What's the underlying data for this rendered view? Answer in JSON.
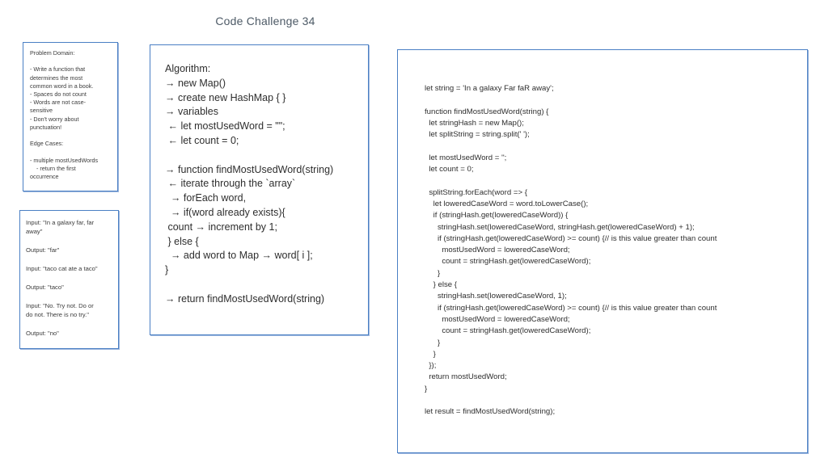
{
  "title": "Code Challenge 34",
  "problem_domain": {
    "lines": [
      "Problem Domain:",
      "",
      "- Write a function that",
      "determines the most",
      "common word in a book.",
      "- Spaces do not count",
      "- Words are not case-",
      "sensitive",
      "- Don't worry about",
      "punctuation!",
      "",
      "Edge Cases:",
      "",
      "- multiple mostUsedWords",
      "    - return the first",
      "occurrence"
    ]
  },
  "examples": {
    "lines": [
      "Input: \"In a galaxy far, far",
      "away\"",
      "",
      "Output: \"far\"",
      "",
      "Input: \"taco cat ate a taco\"",
      "",
      "Output: \"taco\"",
      "",
      "Input: \"No. Try not. Do or",
      "do not. There is no try.\"",
      "",
      "Output: \"no\""
    ]
  },
  "algorithm": {
    "lines": [
      "Algorithm:",
      "→ new Map()",
      "→ create new HashMap { }",
      "→ variables",
      " ← let mostUsedWord = \"\";",
      " ← let count = 0;",
      "",
      "→ function findMostUsedWord(string)",
      " ← iterate through the `array`",
      "  → forEach word,",
      "  → if(word already exists){",
      " count → increment by 1;",
      " } else {",
      "  → add word to Map → word[ i ];",
      "}",
      "",
      "→ return findMostUsedWord(string)"
    ]
  },
  "code": {
    "lines": [
      "let string = 'In a galaxy Far faR away';",
      "",
      "function findMostUsedWord(string) {",
      "  let stringHash = new Map();",
      "  let splitString = string.split(' ');",
      "",
      "  let mostUsedWord = '';",
      "  let count = 0;",
      "",
      "  splitString.forEach(word => {",
      "    let loweredCaseWord = word.toLowerCase();",
      "    if (stringHash.get(loweredCaseWord)) {",
      "      stringHash.set(loweredCaseWord, stringHash.get(loweredCaseWord) + 1);",
      "      if (stringHash.get(loweredCaseWord) >= count) {// is this value greater than count",
      "        mostUsedWord = loweredCaseWord;",
      "        count = stringHash.get(loweredCaseWord);",
      "      }",
      "    } else {",
      "      stringHash.set(loweredCaseWord, 1);",
      "      if (stringHash.get(loweredCaseWord) >= count) {// is this value greater than count",
      "        mostUsedWord = loweredCaseWord;",
      "        count = stringHash.get(loweredCaseWord);",
      "      }",
      "    }",
      "  });",
      "  return mostUsedWord;",
      "}",
      "",
      "let result = findMostUsedWord(string);"
    ]
  }
}
